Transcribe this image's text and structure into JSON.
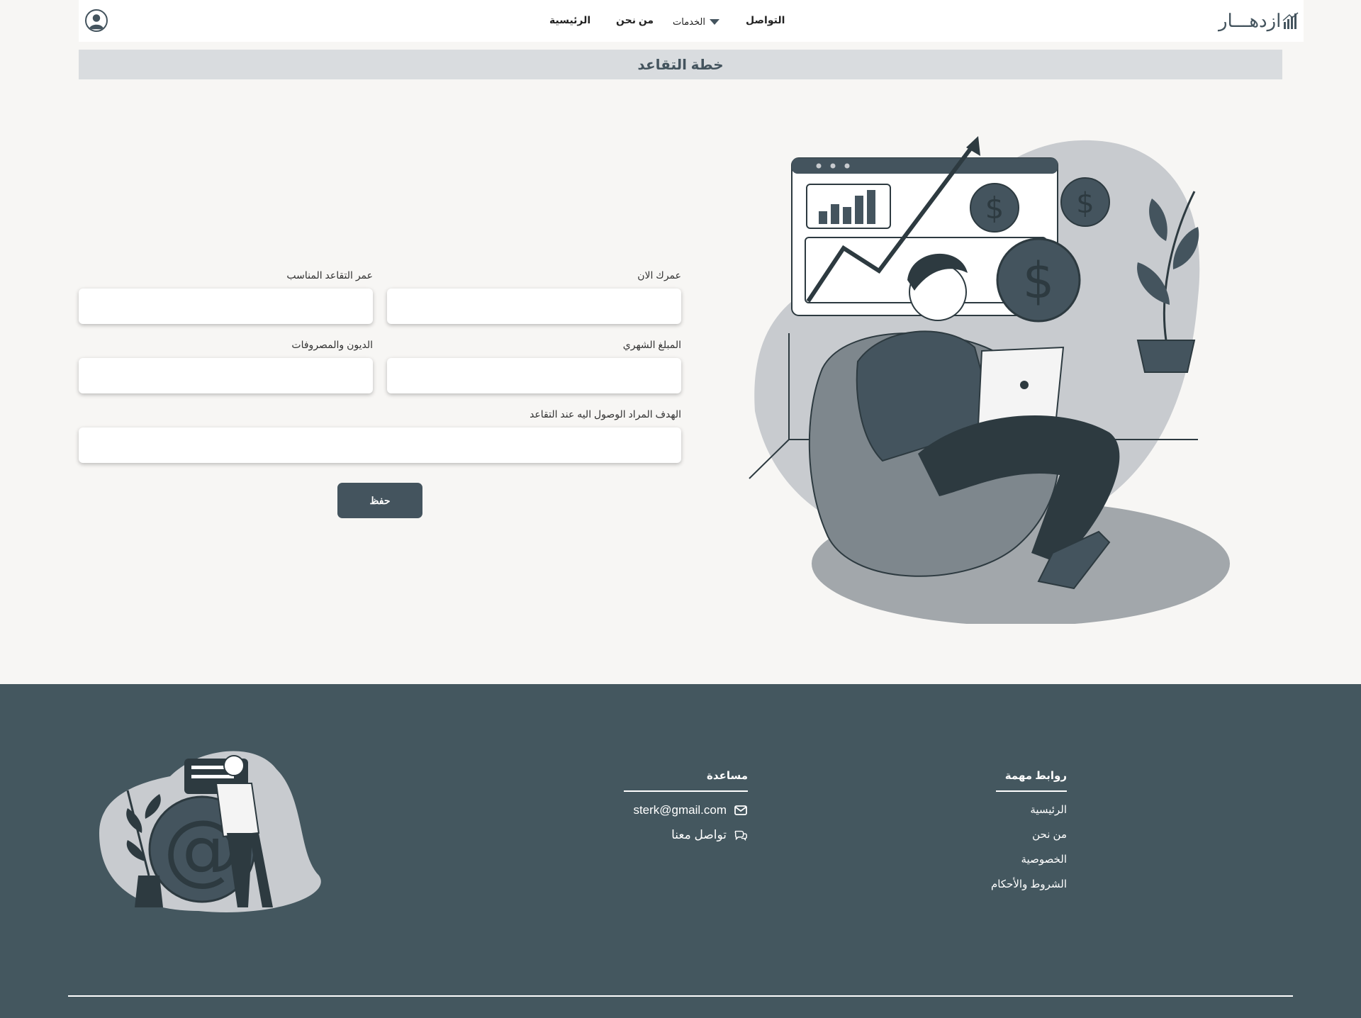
{
  "nav": {
    "brand": "ازدهـــار",
    "links": {
      "contact": "التواصل",
      "services": "الخدمات",
      "about": "من نحن",
      "home": "الرئيسية"
    }
  },
  "page": {
    "title": "خطة التقاعد"
  },
  "form": {
    "current_age_label": "عمرك الان",
    "current_age_value": "",
    "retire_age_label": "عمر التقاعد المناسب",
    "retire_age_value": "",
    "monthly_amount_label": "المبلغ الشهري",
    "monthly_amount_value": "",
    "debts_label": "الديون والمصروفات",
    "debts_value": "",
    "goal_label": "الهدف المراد الوصول اليه عند التقاعد",
    "goal_value": "",
    "save_label": "حفظ"
  },
  "footer": {
    "links_heading": "روابط مهمة",
    "links": [
      "الرئيسية",
      "من نحن",
      "الخصوصية",
      "الشروط والأحكام"
    ],
    "help_heading": "مساعدة",
    "email": "sterk@gmail.com",
    "contact_us": "تواصل معنا"
  },
  "colors": {
    "primary": "#44545e",
    "footer_bg": "#44575f",
    "page_bg": "#f7f6f4",
    "title_bar_bg": "#d9dcdf"
  },
  "icons": [
    "user-avatar-icon",
    "caret-down-icon",
    "brand-logo-icon",
    "envelope-icon",
    "chat-bubbles-icon"
  ]
}
